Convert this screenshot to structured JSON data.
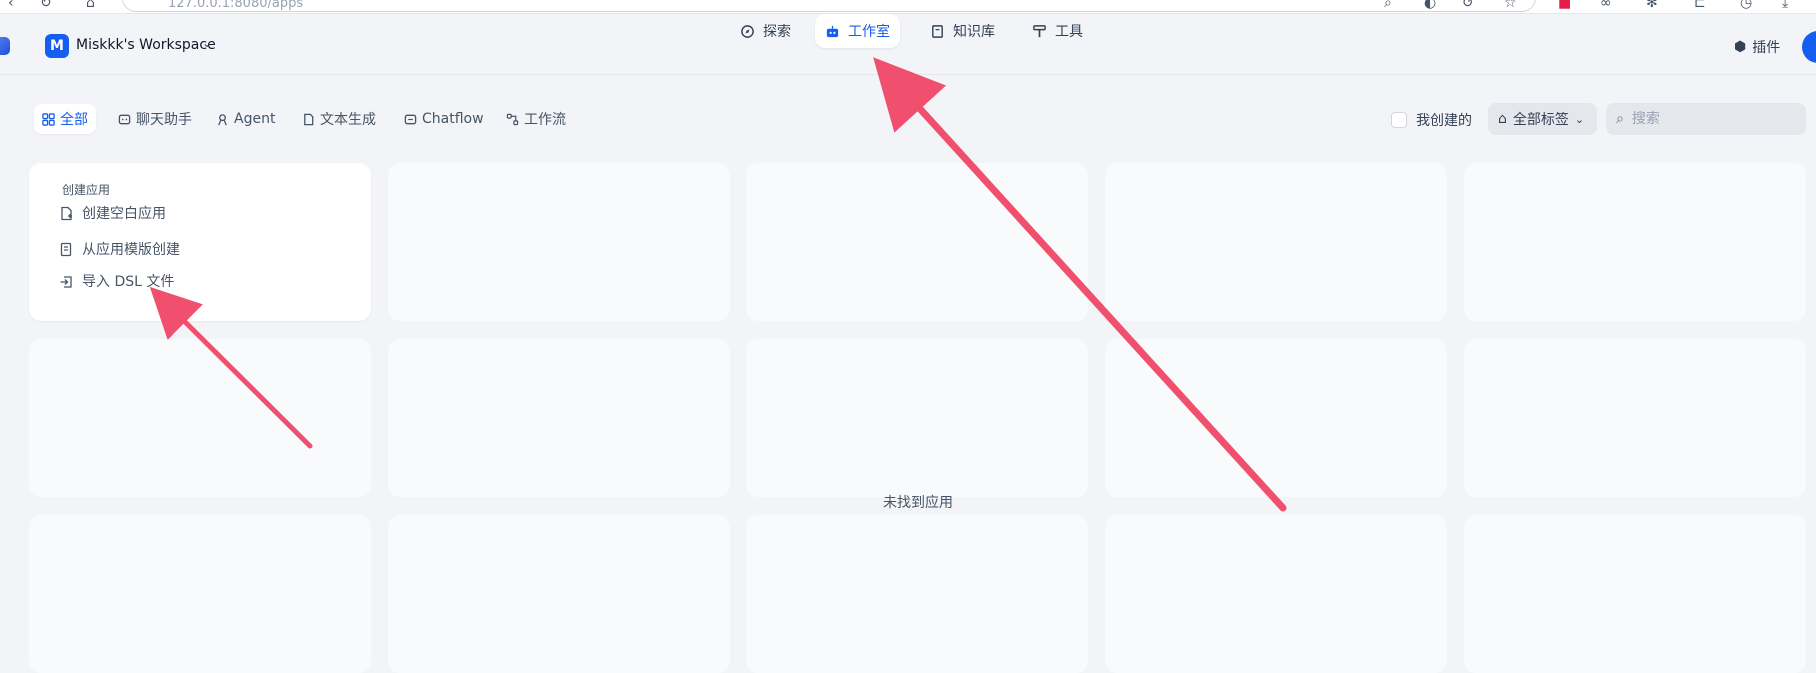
{
  "browser": {
    "url": "127.0.0.1:8080/apps"
  },
  "header": {
    "workspace_initial": "M",
    "workspace_name": "Miskkk's Workspace",
    "nav": [
      {
        "label": "探索",
        "icon": "compass-icon"
      },
      {
        "label": "工作室",
        "icon": "robot-icon",
        "active": true
      },
      {
        "label": "知识库",
        "icon": "book-icon"
      },
      {
        "label": "工具",
        "icon": "hammer-icon"
      }
    ],
    "plugin_label": "插件"
  },
  "filters": {
    "tabs": [
      {
        "label": "全部",
        "icon": "grid-icon",
        "active": true
      },
      {
        "label": "聊天助手",
        "icon": "chat-bot-icon"
      },
      {
        "label": "Agent",
        "icon": "agent-icon"
      },
      {
        "label": "文本生成",
        "icon": "document-icon"
      },
      {
        "label": "Chatflow",
        "icon": "chatflow-icon"
      },
      {
        "label": "工作流",
        "icon": "workflow-icon"
      }
    ],
    "mine_label": "我创建的",
    "tags_label": "全部标签",
    "search_placeholder": "搜索"
  },
  "create_card": {
    "title": "创建应用",
    "items": [
      {
        "label": "创建空白应用",
        "icon": "file-plus-icon"
      },
      {
        "label": "从应用模版创建",
        "icon": "template-icon"
      },
      {
        "label": "导入 DSL 文件",
        "icon": "import-icon"
      }
    ]
  },
  "empty_text": "未找到应用",
  "colors": {
    "accent": "#155eef",
    "annotation_arrow": "#f0506e",
    "background": "#f2f4f7"
  }
}
